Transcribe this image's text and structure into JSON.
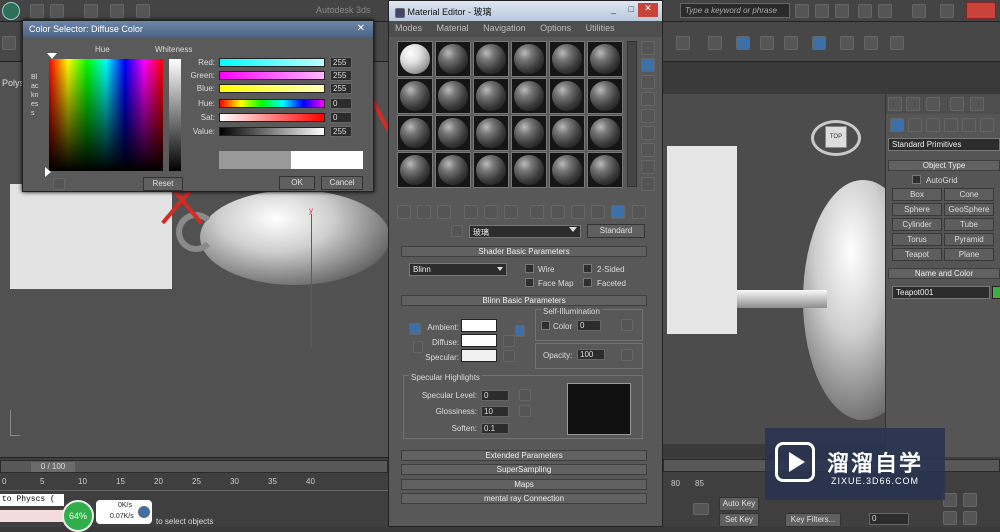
{
  "app": {
    "brand_label": "Autodesk 3ds"
  },
  "search": {
    "placeholder": "Type a keyword or phrase"
  },
  "viewport_left": {
    "label": "Polys"
  },
  "color_selector": {
    "title": "Color Selector: Diffuse Color",
    "hue_label": "Hue",
    "whiteness_label": "Whiteness",
    "blackness_label": "Blackness",
    "channels": [
      {
        "label": "Red:",
        "value": "255"
      },
      {
        "label": "Green:",
        "value": "255"
      },
      {
        "label": "Blue:",
        "value": "255"
      },
      {
        "label": "Hue:",
        "value": "0"
      },
      {
        "label": "Sat:",
        "value": "0"
      },
      {
        "label": "Value:",
        "value": "255"
      }
    ],
    "reset_label": "Reset",
    "ok_label": "OK",
    "cancel_label": "Cancel",
    "close_glyph": "✕"
  },
  "material_editor": {
    "title": "Material Editor - 玻璃",
    "menu": [
      "Modes",
      "Material",
      "Navigation",
      "Options",
      "Utilities"
    ],
    "material_name": "玻璃",
    "material_type": "Standard",
    "shader_params": {
      "title": "Shader Basic Parameters",
      "shader": "Blinn",
      "wire": "Wire",
      "two_sided": "2-Sided",
      "face_map": "Face Map",
      "faceted": "Faceted"
    },
    "blinn_params": {
      "title": "Blinn Basic Parameters",
      "self_illum_label": "Self-Illumination",
      "ambient": "Ambient:",
      "diffuse": "Diffuse:",
      "specular": "Specular:",
      "color_label": "Color",
      "color_value": "0",
      "opacity_label": "Opacity:",
      "opacity_value": "100",
      "spec_highlights_label": "Specular Highlights",
      "spec_level_label": "Specular Level:",
      "spec_level_value": "0",
      "glossiness_label": "Glossiness:",
      "glossiness_value": "10",
      "soften_label": "Soften:",
      "soften_value": "0.1"
    },
    "rollouts": [
      "Extended Parameters",
      "SuperSampling",
      "Maps",
      "mental ray Connection"
    ],
    "win_controls": [
      "_",
      "□",
      "✕"
    ]
  },
  "command_panel": {
    "category": "Standard Primitives",
    "object_type_title": "Object Type",
    "autogrid": "AutoGrid",
    "primitives": [
      "Box",
      "Cone",
      "Sphere",
      "GeoSphere",
      "Cylinder",
      "Tube",
      "Torus",
      "Pyramid",
      "Teapot",
      "Plane"
    ],
    "name_color_title": "Name and Color",
    "object_name": "Teapot001",
    "object_color": "#3fb03f"
  },
  "timeline": {
    "frame_counter": "0 / 100",
    "ticks": [
      "0",
      "5",
      "10",
      "15",
      "20",
      "25",
      "30",
      "35",
      "40"
    ],
    "right_ticks": [
      "80",
      "85"
    ],
    "status_script": "to Physcs (",
    "status_msg": "to select objects",
    "cpu_percent": "64%",
    "net_up": "0K/s",
    "net_down": "0.07K/s",
    "auto_key": "Auto Key",
    "set_key": "Set Key",
    "key_filters": "Key Filters...",
    "frame_value": "0"
  },
  "viewcube": {
    "label": "TOP"
  },
  "axis_label": "y",
  "watermark": {
    "brand": "溜溜自学",
    "url": "ZIXUE.3D66.COM"
  }
}
